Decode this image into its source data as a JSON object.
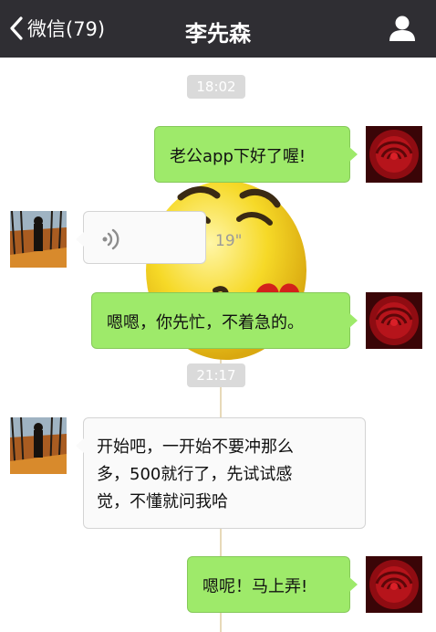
{
  "header": {
    "back_label": "微信(79)",
    "title": "李先森"
  },
  "messages": [
    {
      "type": "time",
      "text": "18:02"
    },
    {
      "type": "text",
      "side": "out",
      "text": "老公app下好了喔!"
    },
    {
      "type": "voice",
      "side": "in",
      "duration": "19\""
    },
    {
      "type": "text",
      "side": "out",
      "text": "嗯嗯，你先忙，不着急的。"
    },
    {
      "type": "time",
      "text": "21:17"
    },
    {
      "type": "text",
      "side": "in",
      "lines": [
        "开始吧，一开始不要冲那么",
        "多，500就行了，先试试感",
        "觉，不懂就问我哈"
      ]
    },
    {
      "type": "text",
      "side": "out",
      "text": "嗯呢！马上弄!"
    }
  ],
  "colors": {
    "header_bg": "#2f2e33",
    "outgoing_bubble": "#9eea6a",
    "incoming_bubble": "#fafafa",
    "time_badge": "#dadada"
  },
  "icons": {
    "back": "chevron-left-icon",
    "profile": "person-icon",
    "voice": "voice-wave-icon",
    "sticker": "kissing-face-balloon"
  }
}
